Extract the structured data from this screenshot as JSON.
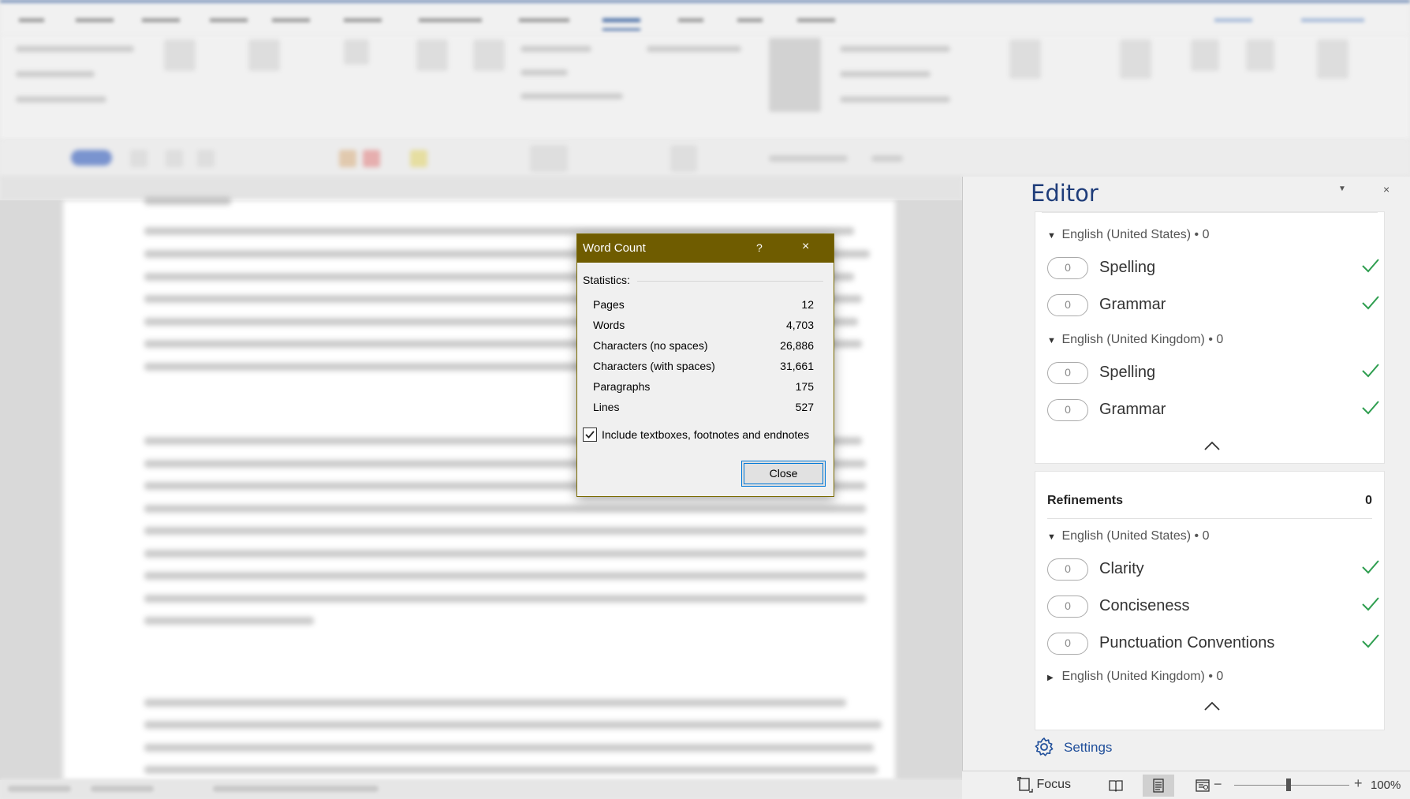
{
  "dialog": {
    "title": "Word Count",
    "help_glyph": "?",
    "close_glyph": "×",
    "statistics_label": "Statistics:",
    "stats": [
      {
        "label": "Pages",
        "value": "12"
      },
      {
        "label": "Words",
        "value": "4,703"
      },
      {
        "label": "Characters (no spaces)",
        "value": "26,886"
      },
      {
        "label": "Characters (with spaces)",
        "value": "31,661"
      },
      {
        "label": "Paragraphs",
        "value": "175"
      },
      {
        "label": "Lines",
        "value": "527"
      }
    ],
    "include_checkbox_label": "Include textboxes, footnotes and endnotes",
    "include_checked": true,
    "close_button": "Close",
    "title_bar_color": "#6f5c00"
  },
  "editor": {
    "title": "Editor",
    "menu_glyph": "▼",
    "close_glyph": "×",
    "corrections": {
      "groups": [
        {
          "language": "English (United States) • 0",
          "expanded": true,
          "items": [
            {
              "name": "Spelling",
              "count": "0"
            },
            {
              "name": "Grammar",
              "count": "0"
            }
          ]
        },
        {
          "language": "English (United Kingdom) • 0",
          "expanded": true,
          "items": [
            {
              "name": "Spelling",
              "count": "0"
            },
            {
              "name": "Grammar",
              "count": "0"
            }
          ]
        }
      ]
    },
    "refinements": {
      "title": "Refinements",
      "count": "0",
      "groups": [
        {
          "language": "English (United States) • 0",
          "expanded": true,
          "items": [
            {
              "name": "Clarity",
              "count": "0"
            },
            {
              "name": "Conciseness",
              "count": "0"
            },
            {
              "name": "Punctuation Conventions",
              "count": "0"
            }
          ]
        },
        {
          "language": "English (United Kingdom) • 0",
          "expanded": false,
          "items": []
        }
      ]
    },
    "settings_label": "Settings",
    "check_color": "#2e9e4f",
    "title_color": "#1f3d7a"
  },
  "statusbar": {
    "focus_label": "Focus",
    "zoom_level": "100%",
    "zoom_minus": "−",
    "zoom_plus": "+"
  },
  "icons": {
    "check": "check-icon",
    "gear": "gear-icon",
    "focus": "focus-icon",
    "read_mode": "read-mode-icon",
    "print_layout": "print-layout-icon",
    "web_layout": "web-layout-icon"
  }
}
